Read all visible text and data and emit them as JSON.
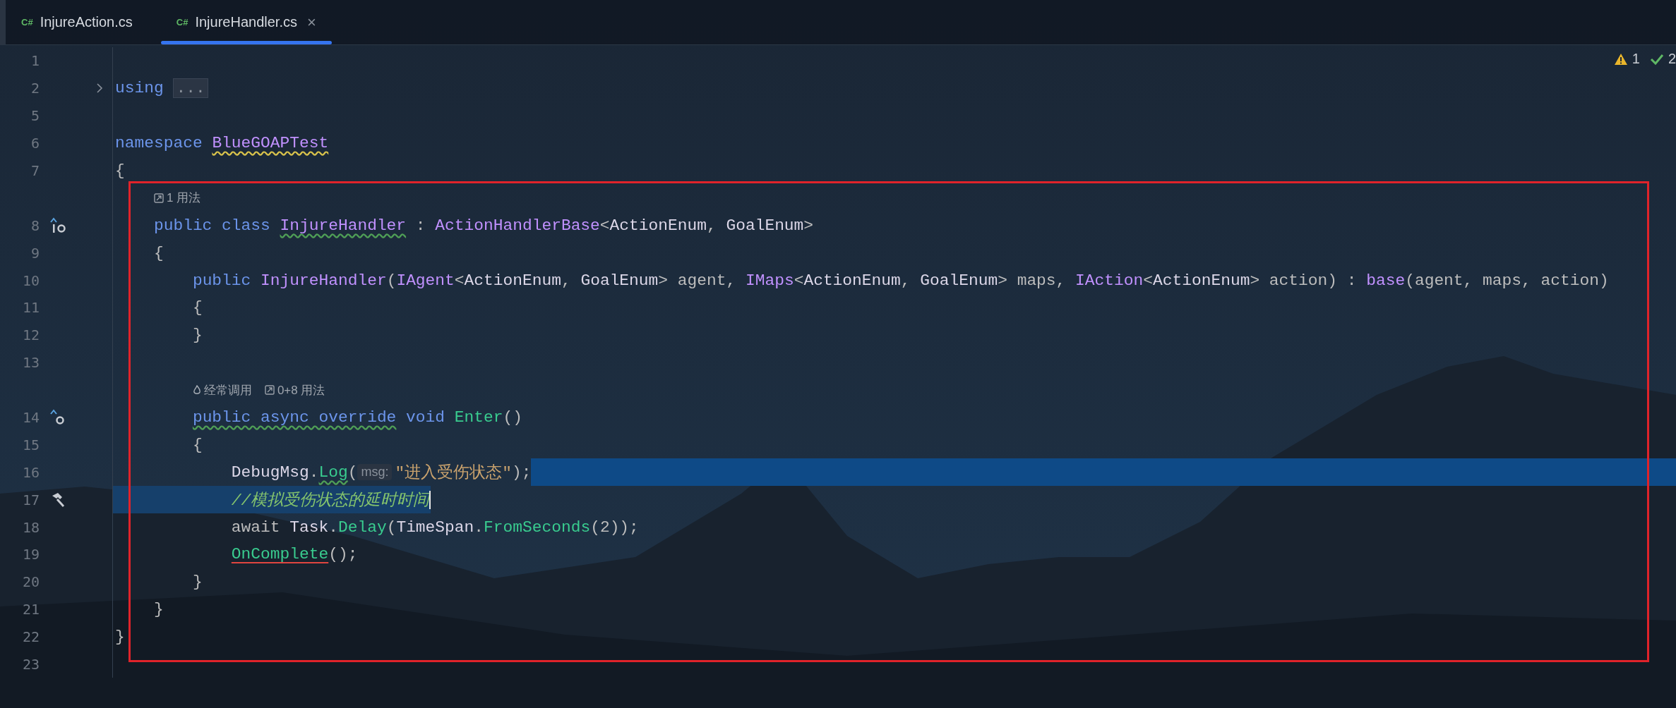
{
  "tabs": [
    {
      "file_type": "C#",
      "label": "InjureAction.cs",
      "selected": false
    },
    {
      "file_type": "C#",
      "label": "InjureHandler.cs",
      "selected": true,
      "close": "×"
    }
  ],
  "inspections": [
    {
      "kind": "warning",
      "count": "1"
    },
    {
      "kind": "ok",
      "count": "2"
    }
  ],
  "lines": [
    {
      "kind": "code",
      "number": "1"
    },
    {
      "kind": "code",
      "number": "2",
      "fold": true,
      "tokens": [
        {
          "kind": "kw",
          "text": "using "
        },
        {
          "kind": "fold",
          "text": "..."
        }
      ]
    },
    {
      "kind": "code",
      "number": "5"
    },
    {
      "kind": "code",
      "number": "6",
      "tokens": [
        {
          "kind": "kw",
          "text": "namespace "
        },
        {
          "kind": "type",
          "text": "BlueGOAPTest",
          "warning": true
        }
      ]
    },
    {
      "kind": "code",
      "number": "7",
      "tokens": [
        {
          "kind": "plain",
          "text": "{"
        }
      ],
      "children": [
        {
          "kind": "lens",
          "items": [
            {
              "kind": "usages",
              "text": "1 用法"
            }
          ]
        },
        {
          "kind": "code",
          "number": "8",
          "implements_marker": true,
          "tokens": [
            {
              "kind": "kw",
              "text": "public class "
            },
            {
              "kind": "type",
              "text": "InjureHandler",
              "typo": true
            },
            {
              "kind": "plain",
              "text": " : "
            },
            {
              "kind": "type",
              "text": "ActionHandlerBase"
            },
            {
              "kind": "plain",
              "text": "<"
            },
            {
              "kind": "ident",
              "text": "ActionEnum"
            },
            {
              "kind": "plain",
              "text": ", "
            },
            {
              "kind": "ident",
              "text": "GoalEnum"
            },
            {
              "kind": "plain",
              "text": ">"
            }
          ]
        },
        {
          "kind": "code",
          "number": "9",
          "tokens": [
            {
              "kind": "plain",
              "text": "{"
            }
          ],
          "children": [
            {
              "kind": "code",
              "number": "10",
              "tokens": [
                {
                  "kind": "kw",
                  "text": "public "
                },
                {
                  "kind": "type",
                  "text": "InjureHandler"
                },
                {
                  "kind": "plain",
                  "text": "("
                },
                {
                  "kind": "type",
                  "text": "IAgent"
                },
                {
                  "kind": "plain",
                  "text": "<"
                },
                {
                  "kind": "ident",
                  "text": "ActionEnum"
                },
                {
                  "kind": "plain",
                  "text": ", "
                },
                {
                  "kind": "ident",
                  "text": "GoalEnum"
                },
                {
                  "kind": "plain",
                  "text": "> agent, "
                },
                {
                  "kind": "type",
                  "text": "IMaps"
                },
                {
                  "kind": "plain",
                  "text": "<"
                },
                {
                  "kind": "ident",
                  "text": "ActionEnum"
                },
                {
                  "kind": "plain",
                  "text": ", "
                },
                {
                  "kind": "ident",
                  "text": "GoalEnum"
                },
                {
                  "kind": "plain",
                  "text": "> maps, "
                },
                {
                  "kind": "type",
                  "text": "IAction"
                },
                {
                  "kind": "plain",
                  "text": "<"
                },
                {
                  "kind": "ident",
                  "text": "ActionEnum"
                },
                {
                  "kind": "plain",
                  "text": "> action) : "
                },
                {
                  "kind": "type",
                  "text": "base"
                },
                {
                  "kind": "plain",
                  "text": "(agent, maps, action)"
                }
              ]
            },
            {
              "kind": "code",
              "number": "11",
              "tokens": [
                {
                  "kind": "plain",
                  "text": "{"
                }
              ]
            },
            {
              "kind": "code",
              "number": "12",
              "tokens": [
                {
                  "kind": "plain",
                  "text": "}"
                }
              ]
            },
            {
              "kind": "code",
              "number": "13"
            },
            {
              "kind": "lens",
              "items": [
                {
                  "kind": "flame",
                  "text": "经常调用"
                },
                {
                  "kind": "usages",
                  "text": "0+8 用法"
                }
              ]
            },
            {
              "kind": "code",
              "number": "14",
              "override_marker": true,
              "tokens": [
                {
                  "kind": "kw",
                  "text": "public async override",
                  "typo": true
                },
                {
                  "kind": "kw",
                  "text": " void "
                },
                {
                  "kind": "method",
                  "text": "Enter"
                },
                {
                  "kind": "plain",
                  "text": "()"
                }
              ]
            },
            {
              "kind": "code",
              "number": "15",
              "tokens": [
                {
                  "kind": "plain",
                  "text": "{"
                }
              ],
              "children": [
                {
                  "kind": "code",
                  "number": "16",
                  "selection_tail": true,
                  "tokens": [
                    {
                      "kind": "ident",
                      "text": "DebugMsg"
                    },
                    {
                      "kind": "plain",
                      "text": "."
                    },
                    {
                      "kind": "method",
                      "text": "Log",
                      "typo": true
                    },
                    {
                      "kind": "plain",
                      "text": "("
                    },
                    {
                      "kind": "hint",
                      "text": "msg:"
                    },
                    {
                      "kind": "string",
                      "text": "\"进入受伤状态\""
                    },
                    {
                      "kind": "plain",
                      "text": ");"
                    }
                  ]
                },
                {
                  "kind": "code",
                  "number": "17",
                  "build_marker": true,
                  "selection_head": true,
                  "caret": true,
                  "tokens": [
                    {
                      "kind": "comment",
                      "text": "//模拟受伤状态的延时时间"
                    }
                  ]
                },
                {
                  "kind": "code",
                  "number": "18",
                  "tokens": [
                    {
                      "kind": "plain",
                      "text": "await "
                    },
                    {
                      "kind": "ident",
                      "text": "Task"
                    },
                    {
                      "kind": "plain",
                      "text": "."
                    },
                    {
                      "kind": "method",
                      "text": "Delay"
                    },
                    {
                      "kind": "plain",
                      "text": "("
                    },
                    {
                      "kind": "ident",
                      "text": "TimeSpan"
                    },
                    {
                      "kind": "plain",
                      "text": "."
                    },
                    {
                      "kind": "method",
                      "text": "FromSeconds"
                    },
                    {
                      "kind": "plain",
                      "text": "(2));"
                    }
                  ]
                },
                {
                  "kind": "code",
                  "number": "19",
                  "tokens": [
                    {
                      "kind": "method",
                      "text": "OnComplete",
                      "error": true
                    },
                    {
                      "kind": "plain",
                      "text": "();"
                    }
                  ]
                }
              ]
            },
            {
              "kind": "code",
              "number": "20",
              "tokens": [
                {
                  "kind": "plain",
                  "text": "}"
                }
              ]
            }
          ]
        },
        {
          "kind": "code",
          "number": "21",
          "tokens": [
            {
              "kind": "plain",
              "text": "}"
            }
          ]
        }
      ]
    },
    {
      "kind": "code",
      "number": "22",
      "tokens": [
        {
          "kind": "plain",
          "text": "}"
        }
      ]
    },
    {
      "kind": "code",
      "number": "23"
    }
  ]
}
